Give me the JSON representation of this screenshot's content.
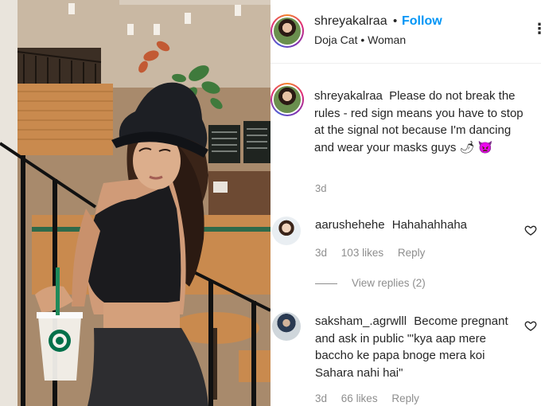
{
  "header": {
    "username": "shreyakalraa",
    "separator": "•",
    "follow_label": "Follow",
    "subtitle": "Doja Cat • Woman",
    "more_icon": "more-options-icon",
    "more_glyph": "⋮"
  },
  "caption": {
    "username": "shreyakalraa",
    "text": "Please do not break the rules - red sign means you have to stop at the signal not because I'm dancing and wear your masks guys 🌶 👿",
    "time": "3d"
  },
  "comments": [
    {
      "username": "aarushehehe",
      "text": "Hahahahhaha",
      "time": "3d",
      "likes": "103 likes",
      "reply_label": "Reply",
      "view_replies": "View replies (2)"
    },
    {
      "username": "saksham_.agrwlll",
      "text": "Become pregnant and ask in public \"'kya aap mere baccho ke papa bnoge mera koi Sahara nahi hai\"",
      "time": "3d",
      "likes": "66 likes",
      "reply_label": "Reply"
    }
  ],
  "photo": {
    "cup_logo": "starbucks-logo-icon"
  },
  "colors": {
    "follow_blue": "#0095f6",
    "text": "#262626",
    "secondary": "#8e8e8e",
    "story_ring": [
      "#f58529",
      "#dd2a7b",
      "#8134af",
      "#515bd4"
    ]
  }
}
